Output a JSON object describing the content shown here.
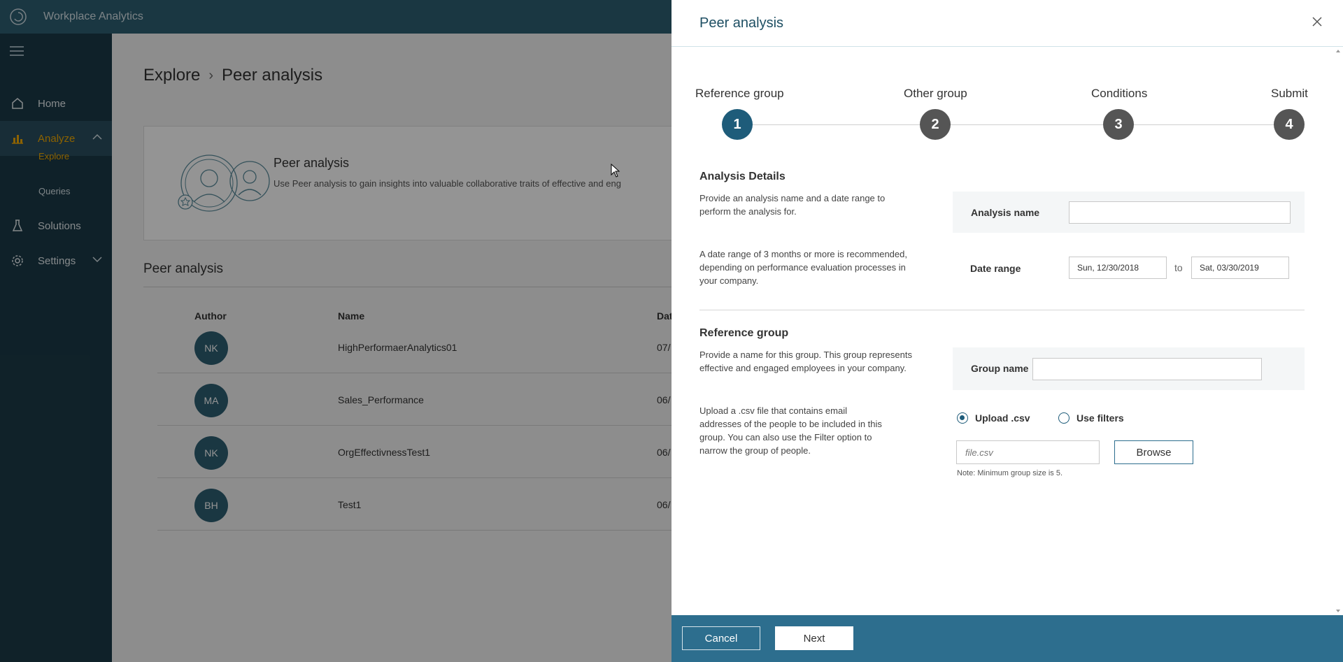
{
  "app": {
    "title": "Workplace Analytics"
  },
  "sidebar": {
    "items": [
      {
        "label": "Home",
        "icon": "home-icon"
      },
      {
        "label": "Analyze",
        "icon": "chart-icon",
        "expanded": true
      },
      {
        "label": "Solutions",
        "icon": "flask-icon"
      },
      {
        "label": "Settings",
        "icon": "gear-icon"
      }
    ],
    "subitems": [
      {
        "label": "Explore",
        "active": true
      },
      {
        "label": "Queries"
      }
    ]
  },
  "breadcrumb": {
    "parent": "Explore",
    "current": "Peer analysis"
  },
  "promo": {
    "title": "Peer analysis",
    "desc": "Use Peer analysis to gain insights into valuable collaborative traits of effective and eng"
  },
  "list": {
    "title": "Peer analysis",
    "columns": {
      "author": "Author",
      "name": "Name",
      "date": "Dat"
    },
    "rows": [
      {
        "initials": "NK",
        "name": "HighPerformaerAnalytics01",
        "date": "07/"
      },
      {
        "initials": "MA",
        "name": "Sales_Performance",
        "date": "06/"
      },
      {
        "initials": "NK",
        "name": "OrgEffectivnessTest1",
        "date": "06/"
      },
      {
        "initials": "BH",
        "name": "Test1",
        "date": "06/"
      }
    ]
  },
  "panel": {
    "title": "Peer analysis",
    "steps": [
      {
        "label": "Reference group",
        "number": "1",
        "active": true
      },
      {
        "label": "Other group",
        "number": "2"
      },
      {
        "label": "Conditions",
        "number": "3"
      },
      {
        "label": "Submit",
        "number": "4"
      }
    ],
    "details": {
      "heading": "Analysis Details",
      "desc1": "Provide an analysis name and a date range to perform the analysis for.",
      "desc2": "A date range of 3 months or more is recommended, depending on performance evaluation processes in your company.",
      "name_label": "Analysis name",
      "name_value": "",
      "date_label": "Date range",
      "date_from": "Sun, 12/30/2018",
      "to": "to",
      "date_to": "Sat, 03/30/2019"
    },
    "reference": {
      "heading": "Reference group",
      "desc1": "Provide a name for this group. This group represents effective and engaged employees in your company.",
      "desc2": "Upload a .csv file that contains email addresses of the people to be included in this group. You can also use the Filter option to narrow the group of people.",
      "group_label": "Group name",
      "group_value": "",
      "radio_upload": "Upload .csv",
      "radio_filters": "Use filters",
      "file_placeholder": "file.csv",
      "browse": "Browse",
      "note": "Note: Minimum group size is 5."
    },
    "footer": {
      "cancel": "Cancel",
      "next": "Next"
    }
  },
  "colors": {
    "primary": "#1e5c7a",
    "accent": "#f2a900",
    "sidebar": "#1b3a47",
    "topbar": "#2d5f73",
    "footer": "#2d6e8e"
  }
}
